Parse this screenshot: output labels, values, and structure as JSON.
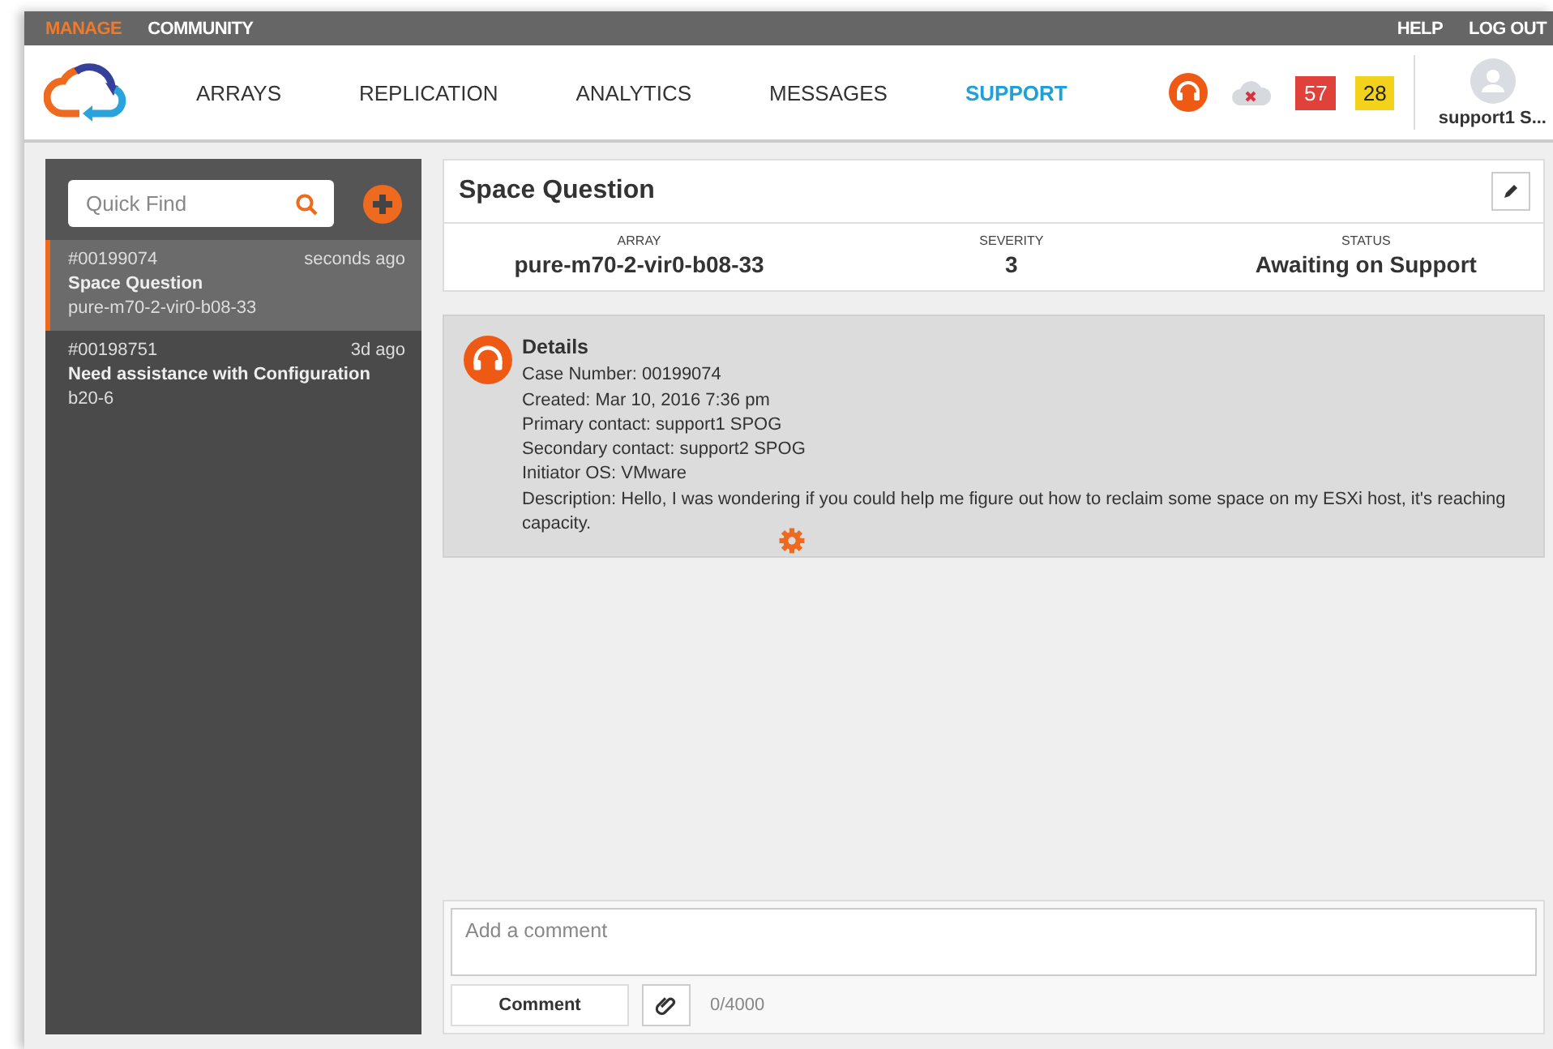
{
  "top_links": [
    {
      "label": "MANAGE",
      "selected": true
    },
    {
      "label": "COMMUNITY",
      "selected": false
    }
  ],
  "top_right_links": [
    "HELP",
    "LOG OUT"
  ],
  "nav": [
    {
      "label": "ARRAYS",
      "selected": false
    },
    {
      "label": "REPLICATION",
      "selected": false
    },
    {
      "label": "ANALYTICS",
      "selected": false
    },
    {
      "label": "MESSAGES",
      "selected": false
    },
    {
      "label": "SUPPORT",
      "selected": true
    }
  ],
  "alerts": [
    {
      "count": "57",
      "color": "#e0413a"
    },
    {
      "count": "28",
      "color": "#f2d21b"
    }
  ],
  "user": {
    "name": "support1 S..."
  },
  "sidebar": {
    "search": {
      "placeholder": "Quick Find"
    },
    "cases": [
      {
        "number": "#00199074",
        "time": "seconds ago",
        "title": "Space Question",
        "array": "pure-m70-2-vir0-b08-33",
        "selected": true
      },
      {
        "number": "#00198751",
        "time": "3d ago",
        "title": "Need assistance with Configuration",
        "array": "b20-6",
        "selected": false
      }
    ]
  },
  "case": {
    "title": "Space Question",
    "fields": [
      {
        "label": "ARRAY",
        "value": "pure-m70-2-vir0-b08-33"
      },
      {
        "label": "SEVERITY",
        "value": "3"
      },
      {
        "label": "STATUS",
        "value": "Awaiting on Support"
      }
    ]
  },
  "details": {
    "heading": "Details",
    "lines": [
      "Case Number: 00199074",
      "Created: Mar 10, 2016 7:36 pm",
      "Primary contact: support1 SPOG",
      "Secondary contact: support2 SPOG",
      "Initiator OS: VMware",
      "Description: Hello, I was wondering if you could help me figure out how to reclaim some space on my ESXi host, it's reaching capacity."
    ]
  },
  "comment": {
    "placeholder": "Add a comment",
    "button": "Comment",
    "counter": "0/4000"
  }
}
